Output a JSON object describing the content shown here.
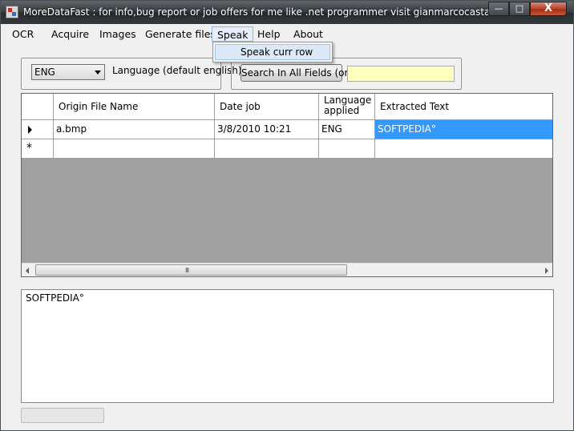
{
  "window": {
    "title": "MoreDataFast : for info,bug report or  job offers for me like .net programmer visit gianmarcocastagna.som...",
    "minimize_glyph": "—",
    "maximize_glyph": "□",
    "close_glyph": "X"
  },
  "menu": {
    "items": [
      "OCR",
      "Acquire",
      "Images",
      "Generate files",
      "Speak",
      "Help",
      "About"
    ],
    "open_menu": "Speak",
    "dropdown_items": [
      "Speak curr row"
    ]
  },
  "language": {
    "selected": "ENG",
    "label": "Language (default english)"
  },
  "search": {
    "button_label": "Search In All Fields (or)",
    "value": ""
  },
  "grid": {
    "columns": [
      "Origin File Name",
      "Date job",
      "Language applied",
      "Extracted Text"
    ],
    "rows": [
      {
        "file": "a.bmp",
        "date": "3/8/2010  10:21",
        "language": "ENG",
        "text": "SOFTPEDIA°"
      }
    ],
    "new_row_marker": "*",
    "scroll_grip": "III"
  },
  "extracted_text": "SOFTPEDIA°",
  "colors": {
    "selection": "#3399ff",
    "search_field": "#ffffc0"
  }
}
